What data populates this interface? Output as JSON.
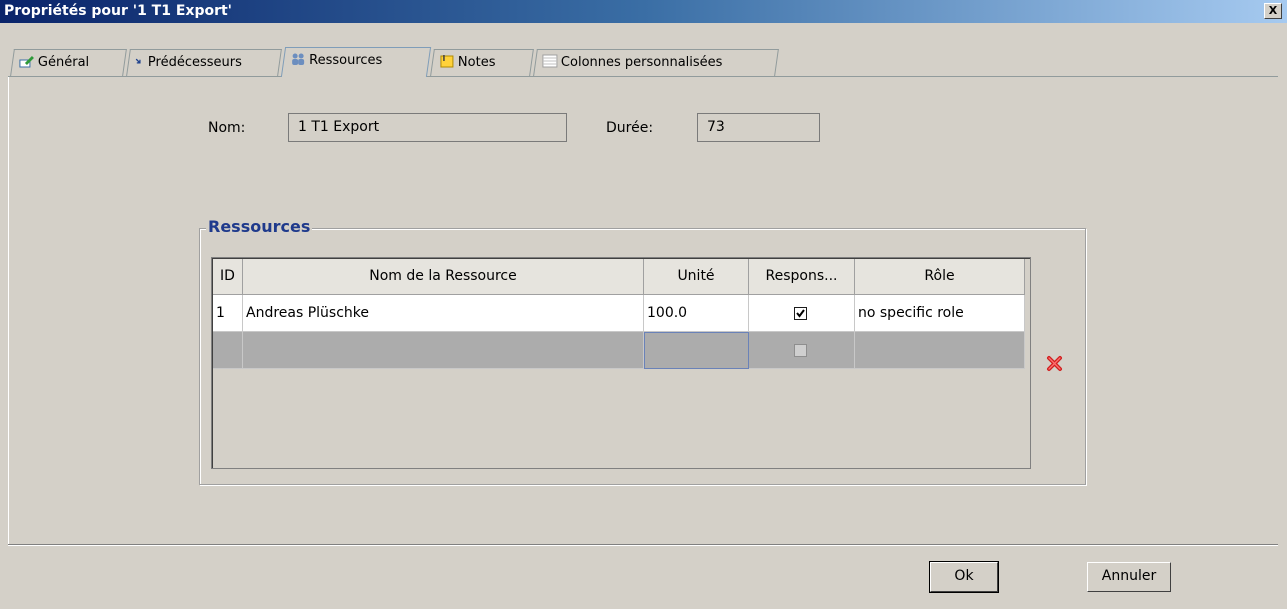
{
  "window": {
    "title": "Propriétés pour '1 T1 Export'",
    "close_label": "X"
  },
  "tabs": [
    {
      "label": "Général",
      "icon": "pencil-edit-icon"
    },
    {
      "label": "Prédécesseurs",
      "icon": "arrow-down-right-icon"
    },
    {
      "label": "Ressources",
      "icon": "people-icon",
      "active": true
    },
    {
      "label": "Notes",
      "icon": "note-paper-icon"
    },
    {
      "label": "Colonnes personnalisées",
      "icon": "table-columns-icon"
    }
  ],
  "form": {
    "name_label": "Nom:",
    "name_value": "1 T1 Export",
    "duration_label": "Durée:",
    "duration_value": "73"
  },
  "resources": {
    "group_title": "Ressources",
    "columns": [
      "ID",
      "Nom de la Ressource",
      "Unité",
      "Respons...",
      "Rôle"
    ],
    "rows": [
      {
        "id": "1",
        "name": "Andreas Plüschke",
        "unit": "100.0",
        "responsible": true,
        "role": "no specific role"
      },
      {
        "id": "",
        "name": "",
        "unit": "",
        "responsible": false,
        "role": ""
      }
    ],
    "delete_icon": "red-x-delete-icon"
  },
  "buttons": {
    "ok": "Ok",
    "cancel": "Annuler"
  },
  "colors": {
    "title_gradient_start": "#0a246a",
    "group_title": "#1f3a8c",
    "delete": "#d02020"
  }
}
